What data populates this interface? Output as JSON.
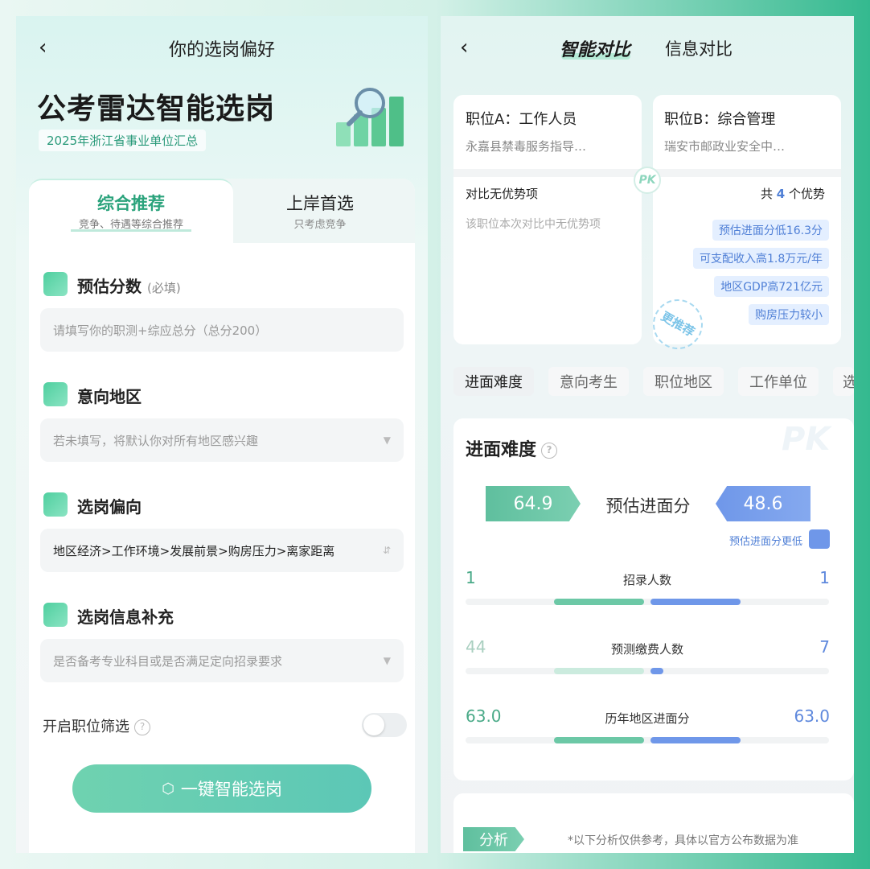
{
  "left": {
    "title": "你的选岗偏好",
    "brand": "公考雷达智能选岗",
    "brand_sub": "2025年浙江省事业单位汇总",
    "tabs": [
      {
        "label": "综合推荐",
        "sub": "竞争、待遇等综合推荐"
      },
      {
        "label": "上岸首选",
        "sub": "只考虑竞争"
      }
    ],
    "sections": [
      {
        "title": "预估分数",
        "note": "(必填)",
        "placeholder": "请填写你的职测+综应总分（总分200）",
        "icon": "score-icon"
      },
      {
        "title": "意向地区",
        "placeholder": "若未填写，将默认你对所有地区感兴趣",
        "icon": "region-icon"
      },
      {
        "title": "选岗偏向",
        "value": "地区经济>工作环境>发展前景>购房压力>离家距离",
        "icon": "preference-icon"
      },
      {
        "title": "选岗信息补充",
        "placeholder": "是否备考专业科目或是否满足定向招录要求",
        "icon": "supplement-icon"
      }
    ],
    "toggle_label": "开启职位筛选",
    "button": "一键智能选岗"
  },
  "right": {
    "tabs": [
      "智能对比",
      "信息对比"
    ],
    "position_a": {
      "title": "职位A：工作人员",
      "sub": "永嘉县禁毒服务指导…"
    },
    "position_b": {
      "title": "职位B：综合管理",
      "sub": "瑞安市邮政业安全中…"
    },
    "pk": "PK",
    "a_adv_head": "对比无优势项",
    "a_adv_none": "该职位本次对比中无优势项",
    "b_adv_head_prefix": "共",
    "b_adv_count": "4",
    "b_adv_head_suffix": "个优势",
    "b_advantages": [
      "预估进面分低16.3分",
      "可支配收入高1.8万元/年",
      "地区GDP高721亿元",
      "购房压力较小"
    ],
    "stamp": "更推荐",
    "categories": [
      "进面难度",
      "意向考生",
      "职位地区",
      "工作单位",
      "选"
    ],
    "difficulty_title": "进面难度",
    "score_a": "64.9",
    "score_label": "预估进面分",
    "score_b": "48.6",
    "lower_note": "预估进面分更低",
    "stats": [
      {
        "label": "招录人数",
        "a": "1",
        "b": "1",
        "a_frac": 1.0,
        "b_frac": 1.0
      },
      {
        "label": "预测缴费人数",
        "a": "44",
        "b": "7",
        "a_frac": 1.0,
        "b_frac": 0.14
      },
      {
        "label": "历年地区进面分",
        "a": "63.0",
        "b": "63.0",
        "a_frac": 1.0,
        "b_frac": 1.0
      }
    ],
    "analysis_tag": "分析",
    "analysis_note": "*以下分析仅供参考，具体以官方公布数据为准"
  },
  "colors": {
    "brand_green": "#2ba37c",
    "brand_blue": "#5f89dd",
    "chip_blue": "#4f7fd6"
  }
}
